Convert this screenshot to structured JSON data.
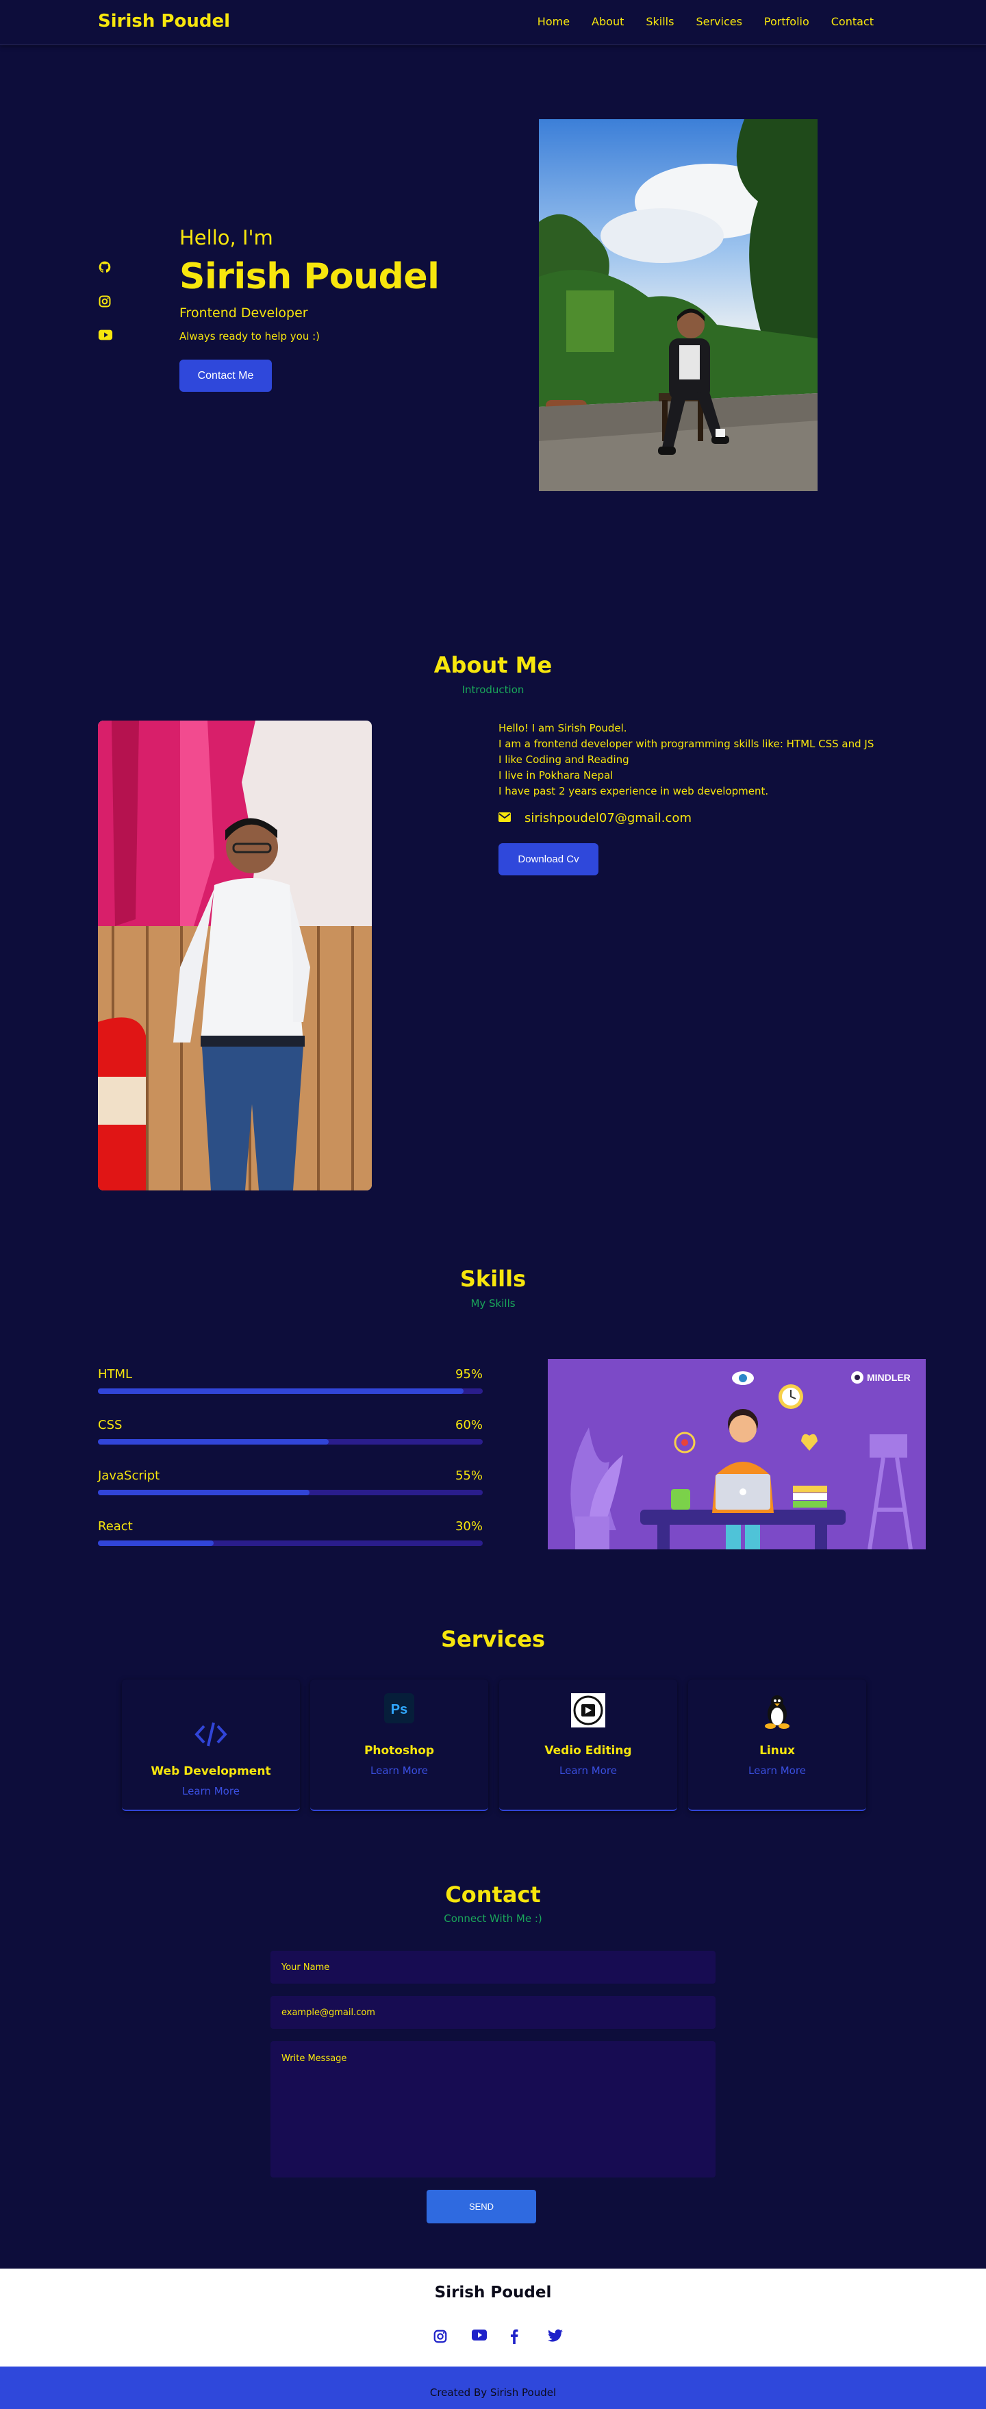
{
  "header": {
    "brand": "Sirish Poudel",
    "nav": [
      "Home",
      "About",
      "Skills",
      "Services",
      "Portfolio",
      "Contact"
    ]
  },
  "hero": {
    "greeting": "Hello, I'm",
    "name": "Sirish Poudel",
    "role": "Frontend Developer",
    "tagline": "Always ready to help you :)",
    "cta": "Contact Me",
    "social_icons": [
      "github-icon",
      "instagram-icon",
      "youtube-icon"
    ]
  },
  "about": {
    "title": "About Me",
    "subtitle": "Introduction",
    "lines": [
      "Hello! I am Sirish Poudel.",
      "I am a frontend developer with programming skills like: HTML CSS and JS",
      "I like Coding and Reading",
      "I live in Pokhara Nepal",
      "I have past 2 years experience in web development."
    ],
    "email": "sirishpoudel07@gmail.com",
    "cv_button": "Download Cv"
  },
  "skills": {
    "title": "Skills",
    "subtitle": "My Skills",
    "items": [
      {
        "name": "HTML",
        "percent_label": "95%",
        "level": 0.95
      },
      {
        "name": "CSS",
        "percent_label": "60%",
        "level": 0.6
      },
      {
        "name": "JavaScript",
        "percent_label": "55%",
        "level": 0.55
      },
      {
        "name": "React",
        "percent_label": "30%",
        "level": 0.3
      }
    ],
    "illustration_logo": "MINDLER"
  },
  "services": {
    "title": "Services",
    "cards": [
      {
        "title": "Web Development",
        "link": "Learn More",
        "icon": "code-icon"
      },
      {
        "title": "Photoshop",
        "link": "Learn More",
        "icon": "photoshop-icon"
      },
      {
        "title": "Vedio Editing",
        "link": "Learn More",
        "icon": "video-editing-icon"
      },
      {
        "title": "Linux",
        "link": "Learn More",
        "icon": "linux-icon"
      }
    ]
  },
  "contact": {
    "title": "Contact",
    "subtitle": "Connect With Me :)",
    "name_placeholder": "Your Name",
    "email_placeholder": "example@gmail.com",
    "message_placeholder": "Write Message",
    "send": "SEND"
  },
  "footer": {
    "name": "Sirish Poudel",
    "icons": [
      "instagram-icon",
      "youtube-icon",
      "facebook-icon",
      "twitter-icon"
    ],
    "credit": "Created By Sirish Poudel"
  },
  "colors": {
    "background": "#0d0d3b",
    "accent_yellow": "#f7e60d",
    "accent_green": "#1aa65a",
    "accent_blue": "#2f48db"
  }
}
